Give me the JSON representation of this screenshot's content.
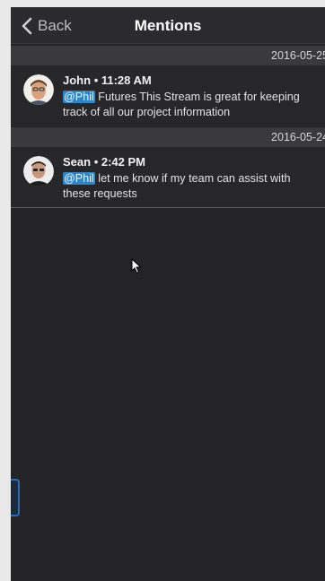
{
  "nav": {
    "back_label": "Back",
    "title": "Mentions"
  },
  "groups": [
    {
      "date": "2016-05-25",
      "messages": [
        {
          "author": "John",
          "time": "11:28 AM",
          "mention": "@Phil",
          "text": " Futures This Stream is great for keeping track of all our project information"
        }
      ]
    },
    {
      "date": "2016-05-24",
      "messages": [
        {
          "author": "Sean",
          "time": "2:42 PM",
          "mention": "@Phil",
          "text": " let me know if my team can assist with these requests"
        }
      ]
    }
  ],
  "colors": {
    "background": "#242427",
    "mention_highlight": "#2f86c7",
    "accent": "#2d6bb8"
  }
}
